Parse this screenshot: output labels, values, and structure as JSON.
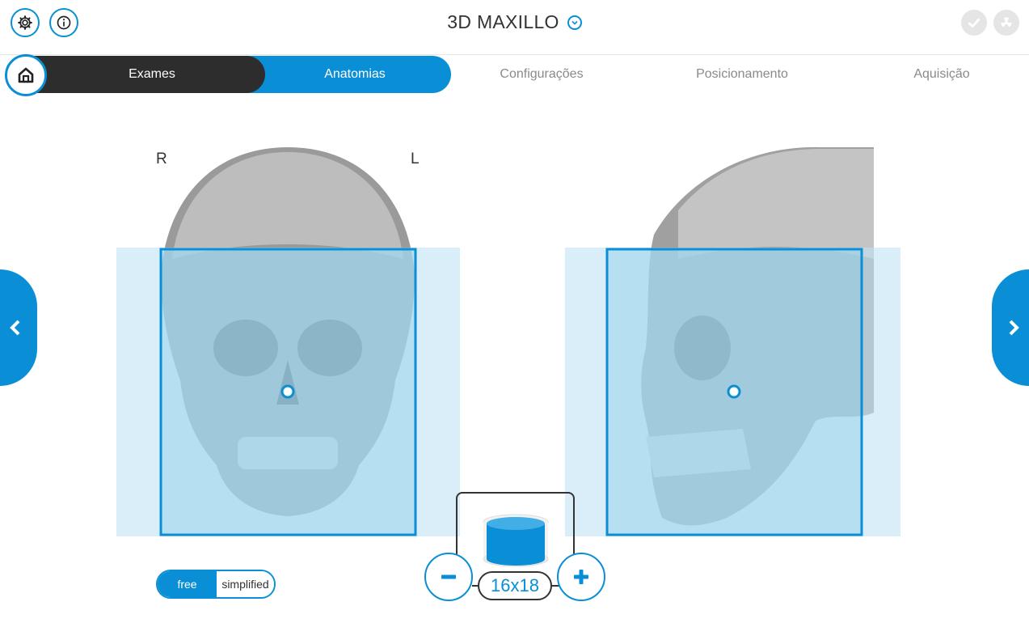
{
  "header": {
    "title": "3D MAXILLO"
  },
  "nav": {
    "tabs": [
      {
        "label": "Exames"
      },
      {
        "label": "Anatomias"
      },
      {
        "label": "Configurações"
      },
      {
        "label": "Posicionamento"
      },
      {
        "label": "Aquisição"
      }
    ],
    "active_tab": "Anatomias"
  },
  "view": {
    "right_label": "R",
    "left_label": "L"
  },
  "mode_toggle": {
    "free_label": "free",
    "simplified_label": "simplified",
    "selected": "free"
  },
  "fov": {
    "value": "16x18"
  },
  "icons": {
    "settings": "gear-icon",
    "info": "info-icon",
    "title_dropdown": "chevron-down-icon",
    "ok_status": "check-icon",
    "radiation_status": "radiation-icon",
    "home": "home-icon",
    "prev": "chevron-left-icon",
    "next": "chevron-right-icon",
    "minus": "minus-icon",
    "plus": "plus-icon",
    "volume": "cylinder-icon"
  },
  "colors": {
    "accent": "#0a8fd6",
    "dark_tab": "#2d2d2d",
    "fov_overlay": "#bfe3f3"
  }
}
